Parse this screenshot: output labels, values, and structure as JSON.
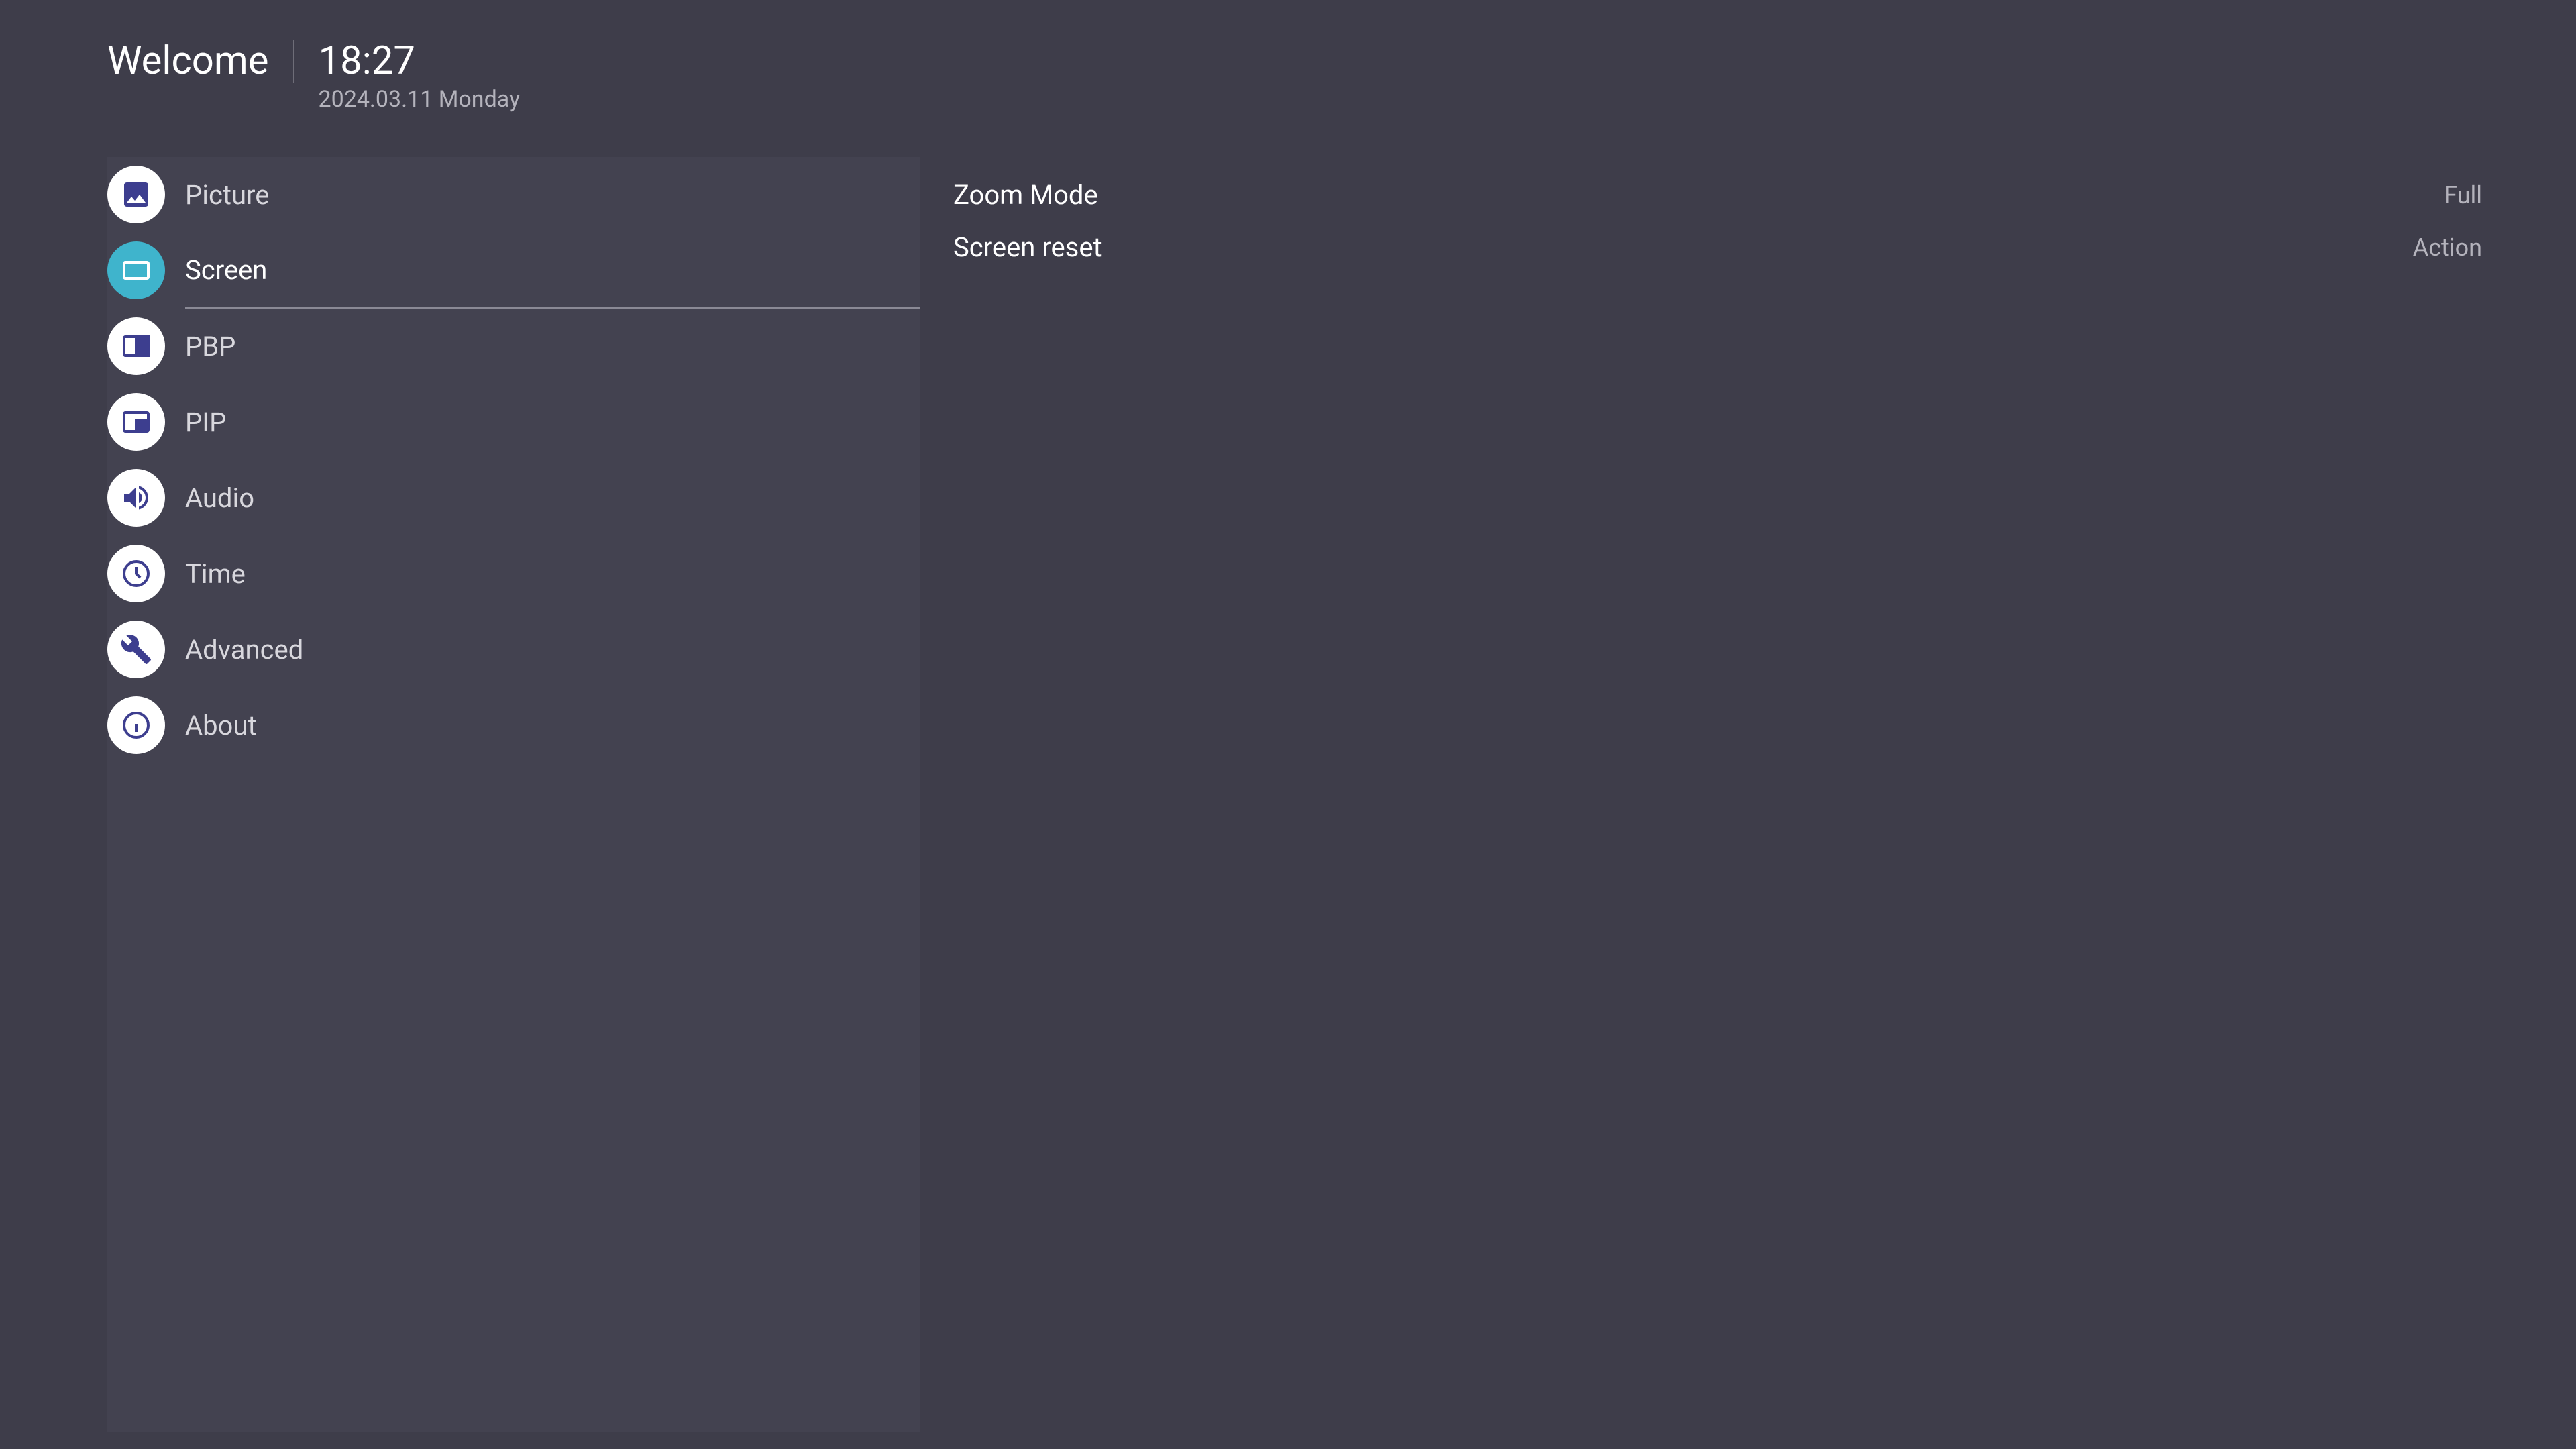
{
  "header": {
    "title": "Welcome",
    "time": "18:27",
    "date": "2024.03.11 Monday"
  },
  "sidebar": {
    "items": [
      {
        "label": "Picture",
        "icon": "picture",
        "active": false
      },
      {
        "label": "Screen",
        "icon": "screen",
        "active": true
      },
      {
        "label": "PBP",
        "icon": "pbp",
        "active": false
      },
      {
        "label": "PIP",
        "icon": "pip",
        "active": false
      },
      {
        "label": "Audio",
        "icon": "audio",
        "active": false
      },
      {
        "label": "Time",
        "icon": "time",
        "active": false
      },
      {
        "label": "Advanced",
        "icon": "advanced",
        "active": false
      },
      {
        "label": "About",
        "icon": "about",
        "active": false
      }
    ]
  },
  "settings": [
    {
      "label": "Zoom Mode",
      "value": "Full"
    },
    {
      "label": "Screen reset",
      "value": "Action"
    }
  ],
  "colors": {
    "background": "#3e3d4a",
    "sidebar_bg": "#434250",
    "icon_bg": "#ffffff",
    "icon_active_bg": "#3fb4cc",
    "icon_color": "#3d3e8f",
    "text_primary": "#ffffff",
    "text_secondary": "#b4b3bc"
  }
}
